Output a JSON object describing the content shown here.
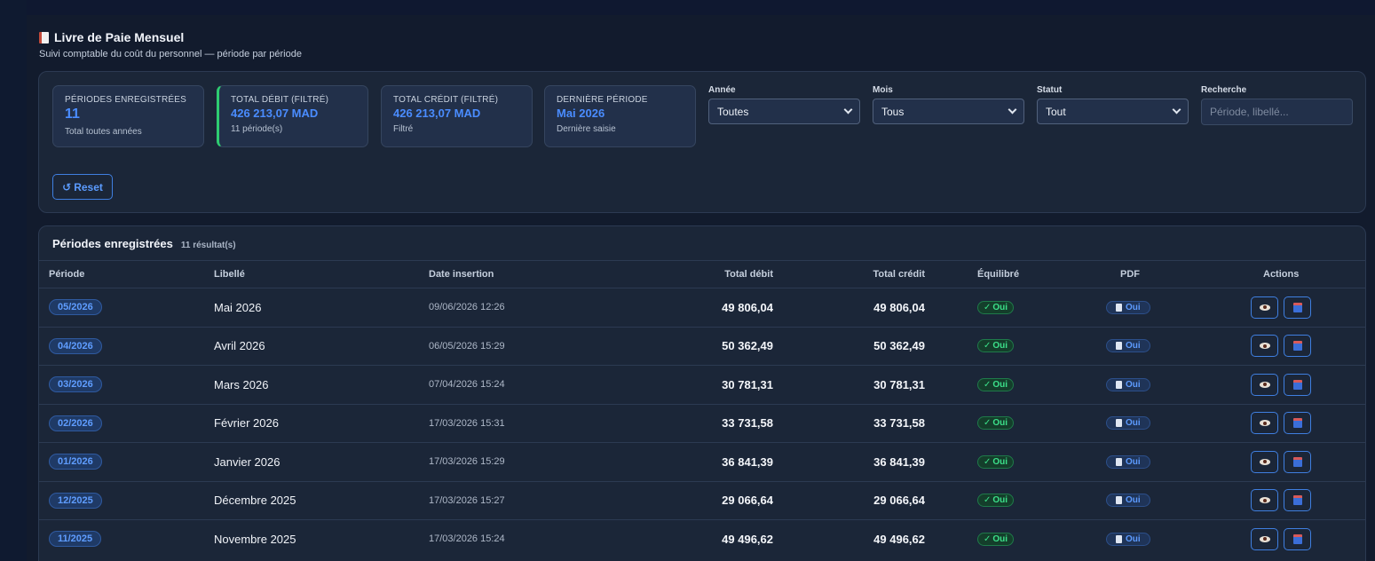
{
  "page": {
    "title": "Livre de Paie Mensuel",
    "subtitle": "Suivi comptable du coût du personnel — période par période"
  },
  "stats": [
    {
      "label": "PÉRIODES ENREGISTRÉES",
      "value": "11",
      "note": "Total toutes années"
    },
    {
      "label": "TOTAL DÉBIT (FILTRÉ)",
      "value": "426 213,07 MAD",
      "note": "11 période(s)"
    },
    {
      "label": "TOTAL CRÉDIT (FILTRÉ)",
      "value": "426 213,07 MAD",
      "note": "Filtré"
    },
    {
      "label": "DERNIÈRE PÉRIODE",
      "value": "Mai 2026",
      "note": "Dernière saisie"
    }
  ],
  "filters": {
    "annee": {
      "label": "Année",
      "value": "Toutes"
    },
    "mois": {
      "label": "Mois",
      "value": "Tous"
    },
    "statut": {
      "label": "Statut",
      "value": "Tout"
    },
    "recherche": {
      "label": "Recherche",
      "placeholder": "Période, libellé..."
    },
    "reset_label": "Reset"
  },
  "table": {
    "title": "Périodes enregistrées",
    "count": "11 résultat(s)",
    "columns": [
      "Période",
      "Libellé",
      "Date insertion",
      "Total débit",
      "Total crédit",
      "Équilibré",
      "PDF",
      "Actions"
    ],
    "rows": [
      {
        "periode": "05/2026",
        "libelle": "Mai 2026",
        "date": "09/06/2026 12:26",
        "debit": "49 806,04",
        "credit": "49 806,04",
        "equilibre": "Oui",
        "pdf": "Oui"
      },
      {
        "periode": "04/2026",
        "libelle": "Avril 2026",
        "date": "06/05/2026 15:29",
        "debit": "50 362,49",
        "credit": "50 362,49",
        "equilibre": "Oui",
        "pdf": "Oui"
      },
      {
        "periode": "03/2026",
        "libelle": "Mars 2026",
        "date": "07/04/2026 15:24",
        "debit": "30 781,31",
        "credit": "30 781,31",
        "equilibre": "Oui",
        "pdf": "Oui"
      },
      {
        "periode": "02/2026",
        "libelle": "Février 2026",
        "date": "17/03/2026 15:31",
        "debit": "33 731,58",
        "credit": "33 731,58",
        "equilibre": "Oui",
        "pdf": "Oui"
      },
      {
        "periode": "01/2026",
        "libelle": "Janvier 2026",
        "date": "17/03/2026 15:29",
        "debit": "36 841,39",
        "credit": "36 841,39",
        "equilibre": "Oui",
        "pdf": "Oui"
      },
      {
        "periode": "12/2025",
        "libelle": "Décembre 2025",
        "date": "17/03/2026 15:27",
        "debit": "29 066,64",
        "credit": "29 066,64",
        "equilibre": "Oui",
        "pdf": "Oui"
      },
      {
        "periode": "11/2025",
        "libelle": "Novembre 2025",
        "date": "17/03/2026 15:24",
        "debit": "49 496,62",
        "credit": "49 496,62",
        "equilibre": "Oui",
        "pdf": "Oui"
      }
    ]
  },
  "icons": {
    "ledger": "ledger-icon",
    "reset": "reset-icon",
    "check": "check-icon",
    "document": "document-icon",
    "view": "eye-icon",
    "book": "book-icon"
  },
  "colors": {
    "accent": "#4a8cff",
    "success": "#3ce08a",
    "panel": "#1b2638",
    "background": "#111a2e"
  }
}
